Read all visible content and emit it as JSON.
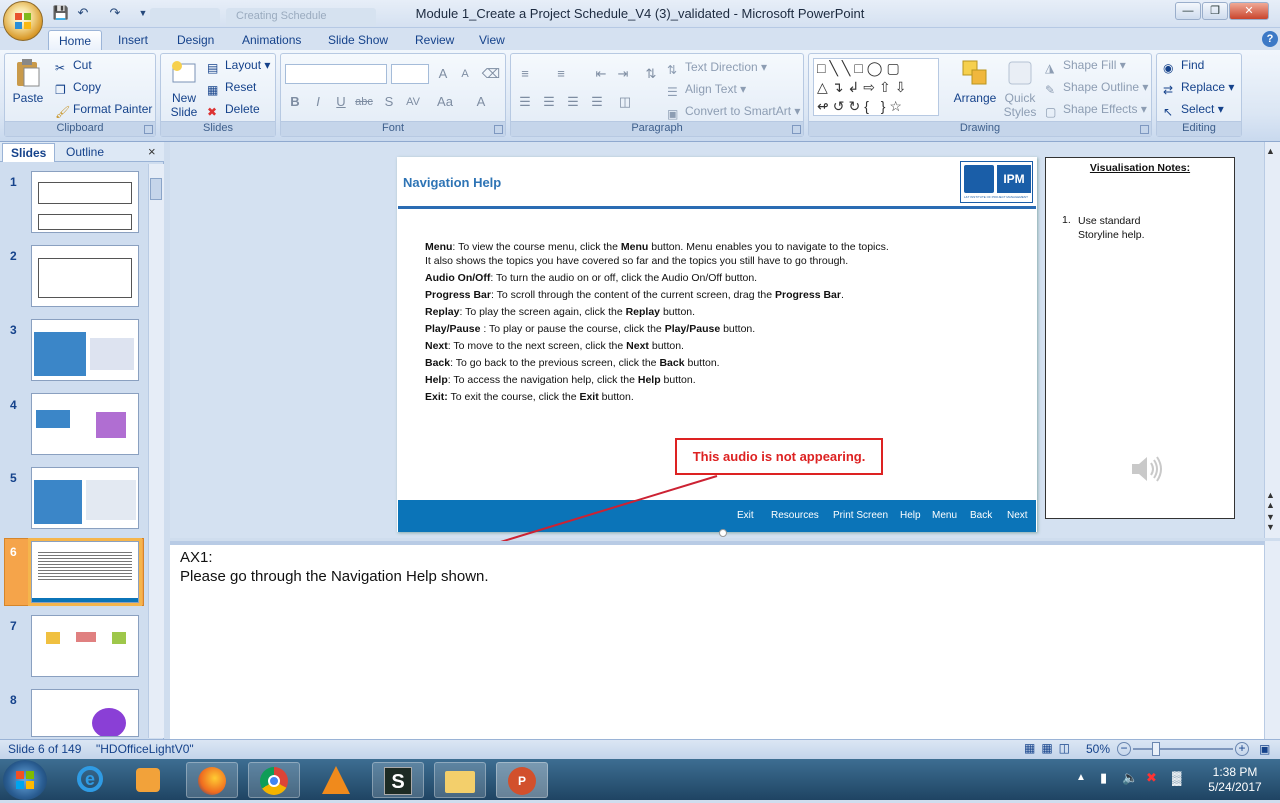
{
  "window": {
    "title": "Module 1_Create a Project Schedule_V4 (3)_validated - Microsoft PowerPoint",
    "ghost_tabs": [
      "",
      "Creating Schedule"
    ]
  },
  "ribbon_tabs": [
    "Home",
    "Insert",
    "Design",
    "Animations",
    "Slide Show",
    "Review",
    "View"
  ],
  "ribbon": {
    "clipboard": {
      "label": "Clipboard",
      "paste": "Paste",
      "cut": "Cut",
      "copy": "Copy",
      "format_painter": "Format Painter"
    },
    "slides": {
      "label": "Slides",
      "new_slide_1": "New",
      "new_slide_2": "Slide",
      "layout": "Layout",
      "reset": "Reset",
      "delete": "Delete"
    },
    "font": {
      "label": "Font",
      "bold": "B",
      "italic": "I",
      "underline": "U",
      "strike": "abc",
      "shadow": "S",
      "spacing": "AV",
      "case": "Aa",
      "color": "A",
      "grow": "A",
      "shrink": "A"
    },
    "paragraph": {
      "label": "Paragraph",
      "text_direction": "Text Direction",
      "align_text": "Align Text",
      "convert_smartart": "Convert to SmartArt"
    },
    "drawing": {
      "label": "Drawing",
      "arrange": "Arrange",
      "quick_styles_1": "Quick",
      "quick_styles_2": "Styles",
      "shape_fill": "Shape Fill",
      "shape_outline": "Shape Outline",
      "shape_effects": "Shape Effects"
    },
    "editing": {
      "label": "Editing",
      "find": "Find",
      "replace": "Replace",
      "select": "Select"
    }
  },
  "left_pane": {
    "tab_slides": "Slides",
    "tab_outline": "Outline",
    "close": "×",
    "thumbnails": [
      {
        "num": "1"
      },
      {
        "num": "2"
      },
      {
        "num": "3"
      },
      {
        "num": "4"
      },
      {
        "num": "5"
      },
      {
        "num": "6"
      },
      {
        "num": "7"
      },
      {
        "num": "8"
      }
    ]
  },
  "slide": {
    "title": "Navigation Help",
    "logo_text": "IPM",
    "logo_sub": "L&T INSTITUTE OF PROJECT MANAGEMENT",
    "body": [
      {
        "term": "Menu",
        "sep": ": To view the course menu, click the ",
        "bold2": "Menu",
        "rest": " button. Menu enables you to navigate to the topics. It also shows the topics you have covered so far and the topics you still have to go through."
      },
      {
        "term": "Audio On/Off",
        "sep": ": To turn the audio on or off, click the Audio On/Off button.",
        "bold2": "",
        "rest": ""
      },
      {
        "term": "Progress Bar",
        "sep": ": To scroll through the content of the current screen, drag the ",
        "bold2": "Progress Bar",
        "rest": "."
      },
      {
        "term": "Replay",
        "sep": ": To play the screen again, click the ",
        "bold2": "Replay",
        "rest": " button."
      },
      {
        "term": "Play/Pause",
        "sep": " : To play or pause the course, click the ",
        "bold2": "Play/Pause",
        "rest": " button."
      },
      {
        "term": "Next",
        "sep": ": To move to the next screen, click the ",
        "bold2": "Next",
        "rest": " button."
      },
      {
        "term": "Back",
        "sep": ": To go back to the previous screen, click the ",
        "bold2": "Back",
        "rest": " button."
      },
      {
        "term": "Help",
        "sep": ": To access the navigation help, click the ",
        "bold2": "Help",
        "rest": " button."
      },
      {
        "term": "Exit:",
        "sep": " To exit the course, click the ",
        "bold2": "Exit",
        "rest": " button."
      }
    ],
    "nav_buttons": [
      "Exit",
      "Resources",
      "Print Screen",
      "Help",
      "Menu",
      "Back",
      "Next"
    ]
  },
  "visualisation_notes": {
    "heading": "Visualisation Notes:",
    "item_num": "1.",
    "item": "Use standard Storyline help."
  },
  "callout": "This audio is not appearing.",
  "notes": {
    "line1": "AX1:",
    "line2": "Please go through the Navigation Help shown."
  },
  "status": {
    "slide_of": "Slide 6 of 149",
    "theme": "\"HDOfficeLightV0\"",
    "zoom": "50%"
  },
  "taskbar": {
    "time": "1:38 PM",
    "date": "5/24/2017"
  },
  "colors": {
    "accent": "#2e74b5",
    "navbar": "#0b74b8",
    "callout": "#dd2222",
    "selected_thumb": "#f5a44a"
  }
}
